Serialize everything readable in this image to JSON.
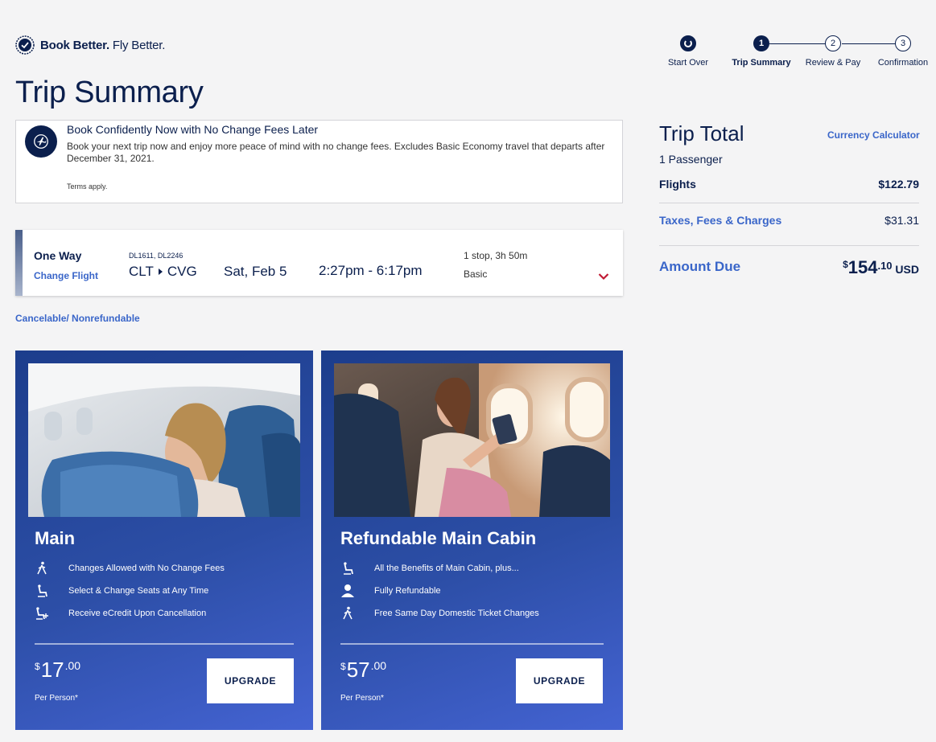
{
  "brand": {
    "bold": "Book Better.",
    "rest": " Fly Better."
  },
  "stepper": {
    "start_over": "Start Over",
    "steps": [
      {
        "num": "1",
        "label": "Trip Summary"
      },
      {
        "num": "2",
        "label": "Review & Pay"
      },
      {
        "num": "3",
        "label": "Confirmation"
      }
    ]
  },
  "page_title": "Trip Summary",
  "notice": {
    "title": "Book Confidently Now with No Change Fees Later",
    "body": "Book your next trip now and enjoy more peace of mind with no change fees. Excludes Basic Economy travel that departs after December 31, 2021.",
    "terms": "Terms apply."
  },
  "flight": {
    "trip_type": "One Way",
    "change_label": "Change Flight",
    "flight_numbers": "DL1611, DL2246",
    "origin": "CLT",
    "destination": "CVG",
    "date": "Sat, Feb 5",
    "times": "2:27pm - 6:17pm",
    "stops": "1 stop, 3h 50m",
    "fare_class": "Basic"
  },
  "fare_note": "Cancelable/ Nonrefundable",
  "upsells": [
    {
      "title": "Main",
      "features": [
        {
          "icon": "walking-traveler-icon",
          "text": "Changes Allowed with No Change Fees"
        },
        {
          "icon": "seat-icon",
          "text": "Select & Change Seats at Any Time"
        },
        {
          "icon": "seat-plus-icon",
          "text": "Receive eCredit Upon Cancellation"
        }
      ],
      "price": {
        "currency": "$",
        "whole": "17",
        "cents": ".00"
      },
      "per_person": "Per Person*",
      "button": "UPGRADE"
    },
    {
      "title": "Refundable Main Cabin",
      "features": [
        {
          "icon": "seat-icon",
          "text": "All the Benefits of Main Cabin, plus..."
        },
        {
          "icon": "person-icon",
          "text": "Fully Refundable"
        },
        {
          "icon": "walking-traveler-icon",
          "text": "Free Same Day Domestic Ticket Changes"
        }
      ],
      "price": {
        "currency": "$",
        "whole": "57",
        "cents": ".00"
      },
      "per_person": "Per Person*",
      "button": "UPGRADE"
    }
  ],
  "trip_total": {
    "title": "Trip Total",
    "currency_calculator": "Currency Calculator",
    "passengers": "1 Passenger",
    "flights_label": "Flights",
    "flights_value": "$122.79",
    "taxes_label": "Taxes, Fees & Charges",
    "taxes_value": "$31.31",
    "due_label": "Amount Due",
    "due_currency": "$",
    "due_whole": "154",
    "due_cents": ".10",
    "due_code": " USD"
  },
  "colors": {
    "navy": "#0b1f4d",
    "link_blue": "#3a66c9",
    "accent_red": "#c01933",
    "card_blue": "#2c4ea6"
  }
}
